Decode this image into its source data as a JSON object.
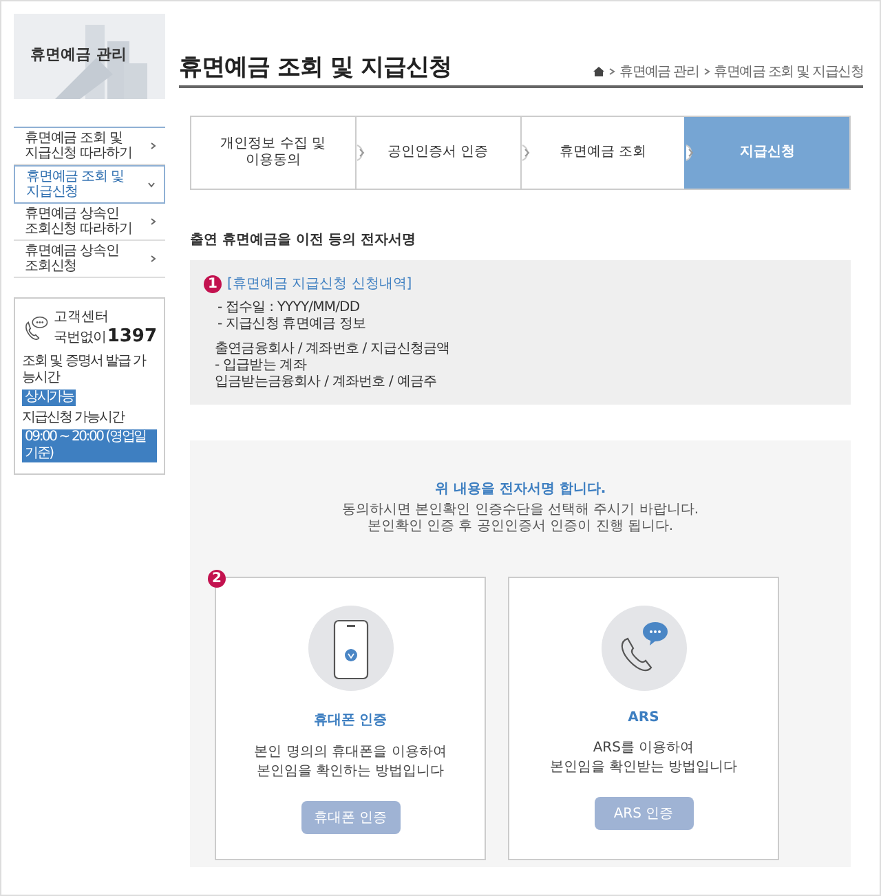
{
  "sidebar": {
    "title": "휴면예금 관리",
    "menu": [
      {
        "label": "휴면예금 조회 및\n지급신청 따라하기",
        "selected": false
      },
      {
        "label": "휴면예금 조회 및\n지급신청",
        "selected": true
      },
      {
        "label": "휴면예금 상속인\n조회신청 따라하기",
        "selected": false
      },
      {
        "label": "휴면예금 상속인\n조회신청",
        "selected": false
      }
    ],
    "contact": {
      "label": "고객센터",
      "prefix": "국번없이",
      "number": "1397",
      "hours": [
        {
          "label": "조회 및 증명서 발급 가능시간",
          "value": "상시가능"
        },
        {
          "label": "지급신청 가능시간",
          "value": "09:00 ~ 20:00 (영업일 기준)"
        }
      ]
    }
  },
  "main": {
    "title": "휴면예금 조회 및 지급신청",
    "breadcrumb": [
      "휴면예금 관리",
      "휴면예금 조회 및 지급신청"
    ],
    "steps": [
      {
        "label": "개인정보 수집 및\n이용동의",
        "selected": false
      },
      {
        "label": "공인인증서 인증",
        "selected": false
      },
      {
        "label": "휴면예금 조회",
        "selected": false
      },
      {
        "label": "지급신청",
        "selected": true
      }
    ],
    "section_title": "출연 휴면예금을 이전 등의 전자서명",
    "summary": {
      "badge": "1",
      "heading": "[휴면예금 지급신청 신청내역]",
      "groups": [
        [
          "- 접수일 : YYYY/MM/DD",
          "- 지급신청 휴면예금 정보"
        ],
        [
          "출연금융회사 / 계좌번호 / 지급신청금액",
          " - 입급받는 계좌",
          "입금받는금융회사 / 계좌번호 / 예금주"
        ]
      ]
    },
    "sign": {
      "heading": "위 내용을 전자서명 합니다.",
      "text": "동의하시면 본인확인 인증수단을 선택해 주시기 바랍니다.\n본인확인 인증 후 공인인증서 인증이 진행 됩니다.",
      "badge": "2",
      "methods": [
        {
          "kind": "phone",
          "title": "휴대폰 인증",
          "text": "본인 명의의 휴대폰을 이용하여\n본인임을 확인하는 방법입니다",
          "button": "휴대폰 인증"
        },
        {
          "kind": "ars",
          "title": "ARS",
          "text": "ARS를 이용하여\n본인임을 확인받는 방법입니다",
          "button": "ARS 인증"
        }
      ]
    }
  }
}
